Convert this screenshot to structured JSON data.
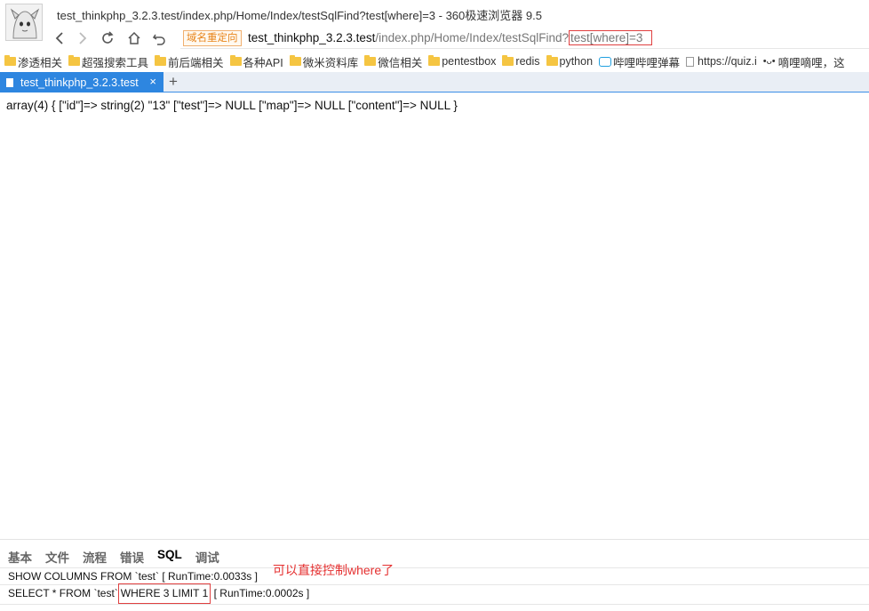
{
  "window": {
    "title": "test_thinkphp_3.2.3.test/index.php/Home/Index/testSqlFind?test[where]=3 - 360极速浏览器 9.5"
  },
  "address_bar": {
    "redirect_badge": "域名重定向",
    "url_host": "test_thinkphp_3.2.3.test",
    "url_path": "/index.php/Home/Index/testSqlFind?",
    "url_query": "test[where]=3"
  },
  "bookmarks": [
    {
      "label": "渗透相关",
      "icon": "folder-icon"
    },
    {
      "label": "超强搜索工具",
      "icon": "folder-icon"
    },
    {
      "label": "前后端相关",
      "icon": "folder-icon"
    },
    {
      "label": "各种API",
      "icon": "folder-icon"
    },
    {
      "label": "微米资料库",
      "icon": "folder-icon"
    },
    {
      "label": "微信相关",
      "icon": "folder-icon"
    },
    {
      "label": "pentestbox",
      "icon": "folder-icon"
    },
    {
      "label": "redis",
      "icon": "folder-icon"
    },
    {
      "label": "python",
      "icon": "folder-icon"
    },
    {
      "label": "哔哩哔哩弹幕",
      "icon": "bilibili-icon"
    },
    {
      "label": "https://quiz.i",
      "icon": "page-icon"
    },
    {
      "label": "嘀哩嘀哩，这",
      "icon": "smile-icon"
    }
  ],
  "tab": {
    "title": "test_thinkphp_3.2.3.test",
    "close": "×",
    "new_tab": "+"
  },
  "content": {
    "dump": "array(4) { [\"id\"]=> string(2) \"13\" [\"test\"]=> NULL [\"map\"]=> NULL [\"content\"]=> NULL }"
  },
  "trace": {
    "tabs": [
      "基本",
      "文件",
      "流程",
      "错误",
      "SQL",
      "调试"
    ],
    "active_tab": "SQL",
    "sql1": "SHOW COLUMNS FROM `test` [ RunTime:0.0033s ]",
    "sql2_prefix": "SELECT * FROM `test`",
    "sql2_highlight": "WHERE 3 LIMIT 1",
    "sql2_suffix": "[ RunTime:0.0002s ]",
    "annotation": "可以直接控制where了"
  },
  "colors": {
    "tab_active": "#2e86e0",
    "highlight_box": "#e04040",
    "annotation": "#e53030",
    "redirect_badge": "#e8841a"
  }
}
